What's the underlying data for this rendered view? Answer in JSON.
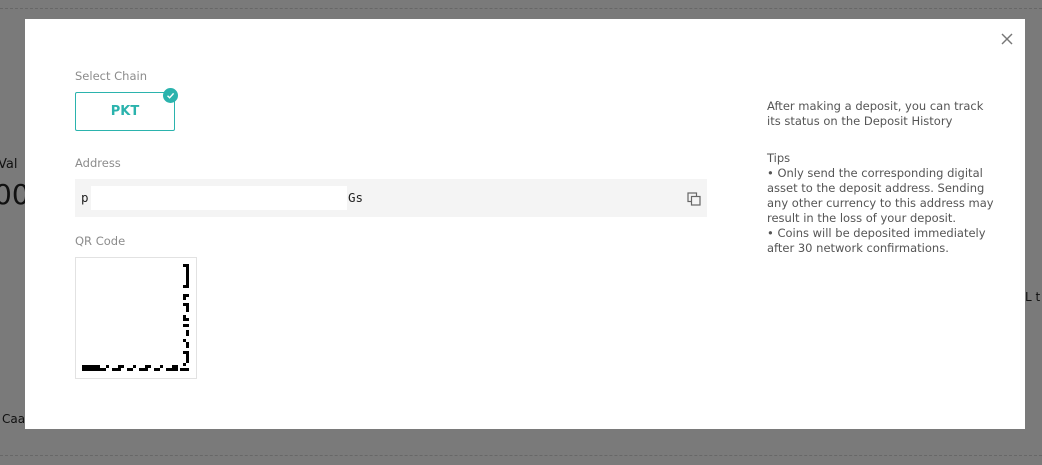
{
  "background": {
    "value_label_fragment": "Val",
    "big_number_fragment": "00",
    "bottom_left_fragment": "Caa",
    "right_edge_fragment": "L t"
  },
  "modal": {
    "close_icon": "close-icon",
    "select_chain": {
      "label": "Select Chain",
      "options": [
        {
          "label": "PKT",
          "selected": true
        }
      ]
    },
    "address": {
      "label": "Address",
      "value_start": "p",
      "value_end": "Gs",
      "copy_icon": "copy-icon"
    },
    "qr": {
      "label": "QR Code"
    },
    "info": {
      "intro": "After making a deposit, you can track its status on the Deposit History",
      "tips_title": "Tips",
      "tips": [
        "• Only send the corresponding digital asset to the deposit address. Sending any other currency to this address may result in the loss of your deposit.",
        "• Coins will be deposited immediately after 30 network confirmations."
      ]
    }
  },
  "colors": {
    "accent": "#2bb3ad",
    "overlay": "rgba(0,0,0,0.5)",
    "label": "#8c8c8c",
    "address_bg": "#f4f4f4"
  }
}
